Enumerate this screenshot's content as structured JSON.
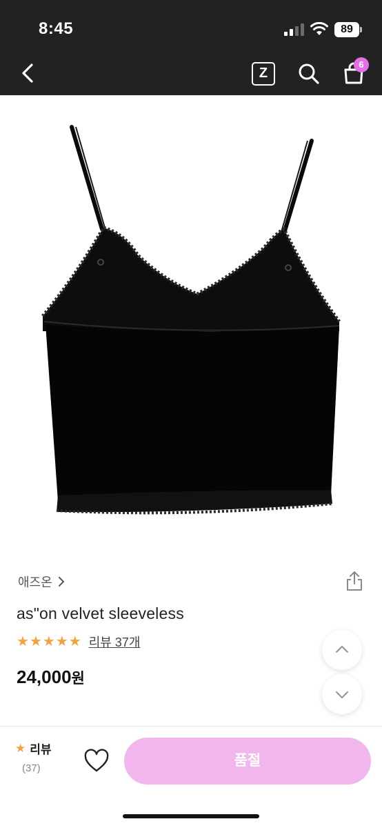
{
  "status_bar": {
    "time": "8:45",
    "battery": "89"
  },
  "header": {
    "z_label": "Z",
    "cart_count": "6",
    "icons": [
      "back-icon",
      "z-icon",
      "search-icon",
      "shopping-bag-icon"
    ]
  },
  "product": {
    "brand": "애즈온",
    "title": "as\"on velvet sleeveless",
    "rating_stars": 5,
    "review_link": "리뷰 37개",
    "price": "24,000",
    "price_unit": "원"
  },
  "bottom_bar": {
    "review_label": "리뷰",
    "review_count": "(37)",
    "soldout_label": "품절"
  },
  "colors": {
    "header_bg": "#222222",
    "badge": "#e46ee8",
    "star": "#f3a33b",
    "soldout_button": "#f1b6ec"
  }
}
